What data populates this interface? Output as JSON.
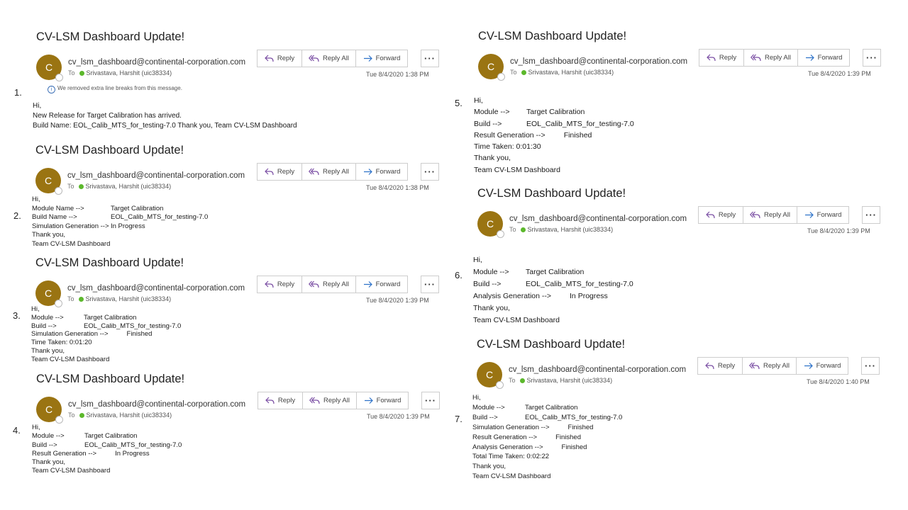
{
  "subject": "CV-LSM Dashboard Update!",
  "sender": "cv_lsm_dashboard@continental-corporation.com",
  "to_label": "To",
  "recipient": "Srivastava, Harshit (uic38334)",
  "avatar_initial": "C",
  "reply_label": "Reply",
  "reply_all_label": "Reply All",
  "forward_label": "Forward",
  "more_label": "···",
  "colors": {
    "avatar": "#9a7412",
    "presence": "#5cb82c",
    "icon": "#7a4ea3",
    "forward_icon": "#2f73c9"
  },
  "emails": [
    {
      "number": "1.",
      "date": "Tue 8/4/2020 1:38 PM",
      "notice": "We removed extra line breaks from this message.",
      "lines": [
        "Hi,",
        "New Release for Target Calibration has arrived.",
        "Build Name: EOL_Calib_MTS_for_testing-7.0 Thank you, Team CV-LSM Dashboard"
      ]
    },
    {
      "number": "2.",
      "date": "Tue 8/4/2020 1:38 PM",
      "rows": [
        {
          "text": "Hi,"
        },
        {
          "label": "Module Name -->",
          "value": "Target Calibration"
        },
        {
          "label": "Build Name -->",
          "value": "EOL_Calib_MTS_for_testing-7.0"
        },
        {
          "label": "Simulation Generation -->",
          "value": "In Progress"
        },
        {
          "text": "Thank you,"
        },
        {
          "text": "Team CV-LSM Dashboard"
        }
      ]
    },
    {
      "number": "3.",
      "date": "Tue 8/4/2020 1:39 PM",
      "rows": [
        {
          "text": "Hi,"
        },
        {
          "label": "Module -->",
          "value": "Target Calibration"
        },
        {
          "label": "Build -->",
          "value": "EOL_Calib_MTS_for_testing-7.0"
        },
        {
          "label": "Simulation Generation -->",
          "value": "Finished"
        },
        {
          "text": "Time Taken: 0:01:20"
        },
        {
          "text": "Thank you,"
        },
        {
          "text": "Team CV-LSM Dashboard"
        }
      ]
    },
    {
      "number": "4.",
      "date": "Tue 8/4/2020 1:39 PM",
      "rows": [
        {
          "text": "Hi,"
        },
        {
          "label": "Module -->",
          "value": "Target Calibration"
        },
        {
          "label": "Build -->",
          "value": "EOL_Calib_MTS_for_testing-7.0"
        },
        {
          "label": "Result Generation -->",
          "value": "In Progress"
        },
        {
          "text": "Thank you,"
        },
        {
          "text": "Team CV-LSM Dashboard"
        }
      ]
    },
    {
      "number": "5.",
      "date": "Tue 8/4/2020 1:39 PM",
      "rows": [
        {
          "text": "Hi,"
        },
        {
          "label": "Module -->",
          "value": "Target Calibration"
        },
        {
          "label": "Build -->",
          "value": "EOL_Calib_MTS_for_testing-7.0"
        },
        {
          "label": "Result Generation -->",
          "value": "Finished"
        },
        {
          "text": "Time Taken: 0:01:30"
        },
        {
          "text": "Thank you,"
        },
        {
          "text": "Team CV-LSM Dashboard"
        }
      ]
    },
    {
      "number": "6.",
      "date": "Tue 8/4/2020 1:39 PM",
      "rows": [
        {
          "text": "Hi,"
        },
        {
          "label": "Module -->",
          "value": "Target Calibration"
        },
        {
          "label": "Build -->",
          "value": "EOL_Calib_MTS_for_testing-7.0"
        },
        {
          "label": "Analysis Generation -->",
          "value": "In Progress"
        },
        {
          "text": "Thank you,"
        },
        {
          "text": "Team CV-LSM Dashboard"
        }
      ]
    },
    {
      "number": "7.",
      "date": "Tue 8/4/2020 1:40 PM",
      "rows": [
        {
          "text": "Hi,"
        },
        {
          "label": "Module -->",
          "value": "Target Calibration"
        },
        {
          "label": "Build -->",
          "value": "EOL_Calib_MTS_for_testing-7.0"
        },
        {
          "label": "Simulation Generation -->",
          "value": "Finished"
        },
        {
          "label": "Result Generation -->",
          "value": "Finished"
        },
        {
          "label": "Analysis Generation -->",
          "value": "Finished"
        },
        {
          "text": "Total Time Taken: 0:02:22"
        },
        {
          "text": "Thank you,"
        },
        {
          "text": "Team CV-LSM Dashboard"
        }
      ]
    }
  ]
}
